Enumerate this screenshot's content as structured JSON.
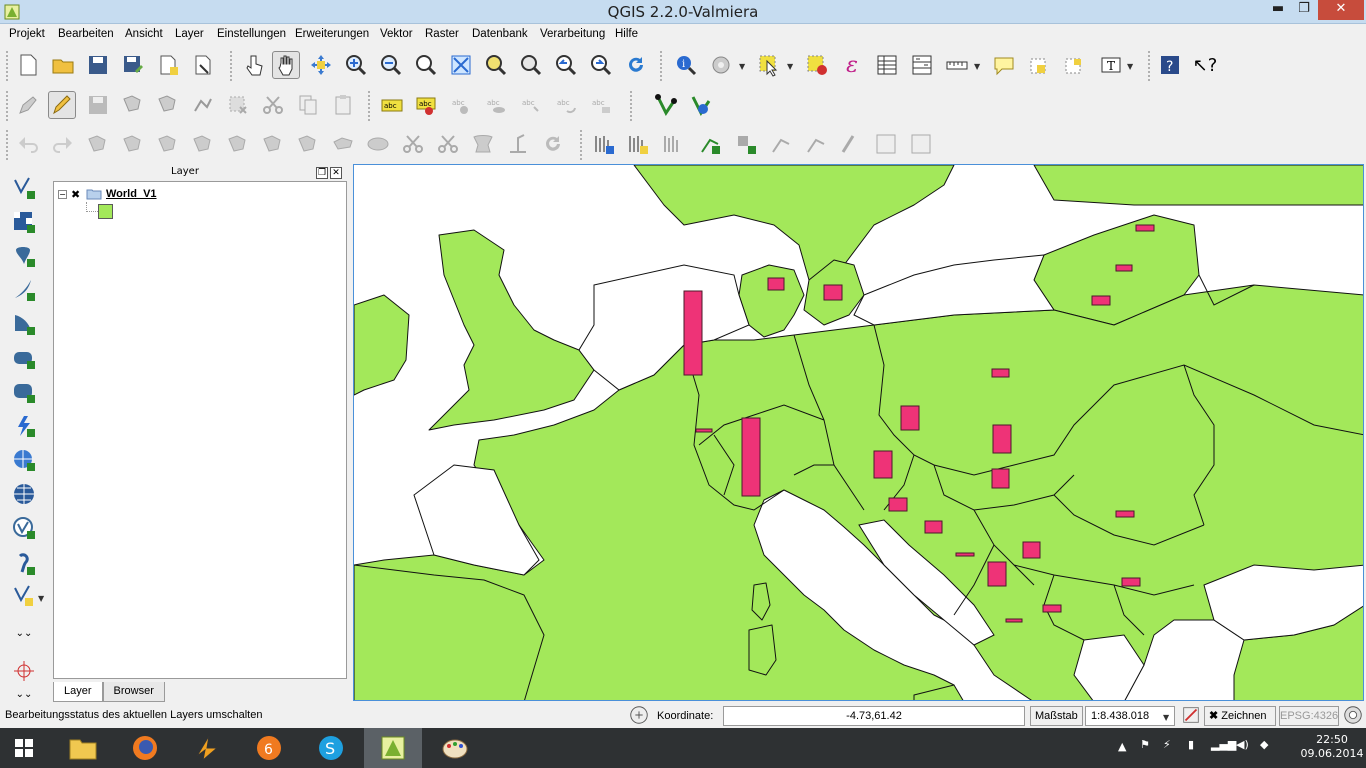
{
  "window": {
    "title": "QGIS 2.2.0-Valmiera",
    "min_glyph": "▬",
    "max_glyph": "❐",
    "close_glyph": "✕"
  },
  "menu": [
    "Projekt",
    "Bearbeiten",
    "Ansicht",
    "Layer",
    "Einstellungen",
    "Erweiterungen",
    "Vektor",
    "Raster",
    "Datenbank",
    "Verarbeitung",
    "Hilfe"
  ],
  "layer_panel": {
    "title": "Layer",
    "layer_name": "World_V1",
    "layer_checked_glyph": "✖",
    "expander_glyph": "−",
    "tabs": [
      "Layer",
      "Browser"
    ],
    "active_tab": "Layer"
  },
  "statusbar": {
    "message": "Bearbeitungsstatus des aktuellen Layers umschalten",
    "coordinate_label": "Koordinate:",
    "coordinate_value": "-4.73,61.42",
    "scale_label": "Maßstab",
    "scale_value": "1:8.438.018",
    "render_label": "Zeichnen",
    "crs_label": "EPSG:4326"
  },
  "taskbar": {
    "time": "22:50",
    "date": "09.06.2014",
    "apps": [
      "file-explorer",
      "firefox",
      "winamp",
      "avast",
      "skype",
      "qgis",
      "paint"
    ]
  },
  "colors": {
    "land": "#a3e85a",
    "bars": "#ee3377",
    "selection": "#4a90d9"
  }
}
